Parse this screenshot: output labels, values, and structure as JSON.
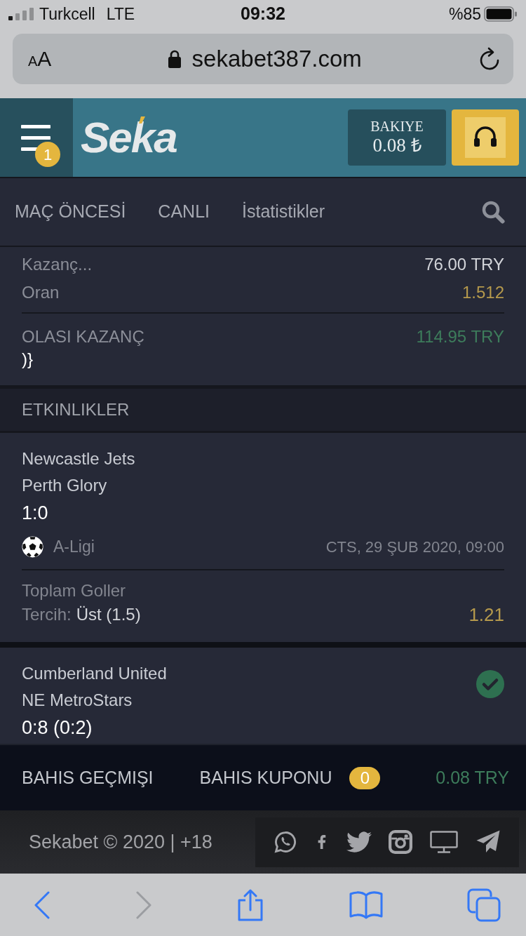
{
  "status_bar": {
    "carrier": "Turkcell",
    "network": "LTE",
    "time": "09:32",
    "battery": "%85"
  },
  "address_bar": {
    "text_size_small": "A",
    "text_size_large": "A",
    "url": "sekabet387.com"
  },
  "header": {
    "menu_badge": "1",
    "logo": "Seka",
    "balance_label": "BAKIYE",
    "balance": "0.08 ₺"
  },
  "nav": {
    "tabs": [
      {
        "label": "MAÇ ÖNCESİ",
        "selected": false
      },
      {
        "label": "CANLI",
        "selected": false
      },
      {
        "label": "İstatistikler",
        "selected": false
      }
    ]
  },
  "summary": {
    "stake": {
      "label": "Kazanç...",
      "value": "76.00 TRY"
    },
    "odds": {
      "label": "Oran",
      "value": "1.512"
    },
    "possible_win": {
      "label": "OLASI KAZANÇ",
      "value": "114.95 TRY"
    },
    "trailing_text": ")}"
  },
  "events_title": "ETKINLIKLER",
  "events": [
    {
      "home": "Newcastle Jets",
      "away": "Perth Glory",
      "score": "1:0",
      "won": false,
      "league": "A-Ligi",
      "date": "CTS, 29 ŞUB 2020, 09:00",
      "market": "Toplam Goller",
      "pick_label": "Tercih:",
      "pick": "Üst (1.5)",
      "odds": "1.21"
    },
    {
      "home": "Cumberland United",
      "away": "NE MetroStars",
      "score": "0:8 (0:2)",
      "won": true
    }
  ],
  "bottom_bar": {
    "history": "BAHIS GEÇMIŞI",
    "slip": "BAHIS KUPONU",
    "slip_count": "0",
    "balance": "0.08 TRY"
  },
  "footer": {
    "copyright": "Sekabet © 2020 | +18"
  },
  "toolbar": {
    "back": {
      "disabled": false
    },
    "forward": {
      "disabled": true
    }
  }
}
